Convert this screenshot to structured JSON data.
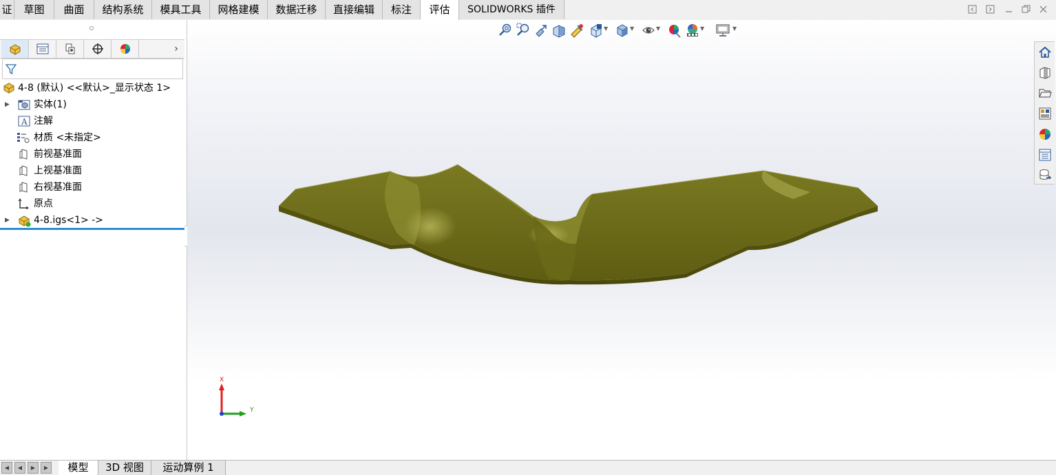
{
  "ribbon": {
    "tabs": [
      {
        "label": "证"
      },
      {
        "label": "草图"
      },
      {
        "label": "曲面"
      },
      {
        "label": "结构系统"
      },
      {
        "label": "模具工具"
      },
      {
        "label": "网格建模"
      },
      {
        "label": "数据迁移"
      },
      {
        "label": "直接编辑"
      },
      {
        "label": "标注"
      },
      {
        "label": "评估"
      },
      {
        "label": "SOLIDWORKS 插件"
      }
    ],
    "active_tab": "评估"
  },
  "window_controls": [
    "restore-left-icon",
    "restore-right-icon",
    "minimize-icon",
    "maximize-icon",
    "close-icon"
  ],
  "feature_manager": {
    "panel_tabs": [
      "feature-manager-icon",
      "property-manager-icon",
      "configuration-manager-icon",
      "dimxpert-icon",
      "display-manager-icon"
    ],
    "more_arrow": "›",
    "tree": [
      {
        "label": "4-8 (默认) <<默认>_显示状态 1>",
        "icon": "part-icon",
        "expandable": false
      },
      {
        "label": "实体(1)",
        "icon": "solid-bodies-icon",
        "expandable": true
      },
      {
        "label": "注解",
        "icon": "annotations-icon",
        "expandable": false
      },
      {
        "label": "材质 <未指定>",
        "icon": "material-icon",
        "expandable": false
      },
      {
        "label": "前视基准面",
        "icon": "plane-icon",
        "expandable": false
      },
      {
        "label": "上视基准面",
        "icon": "plane-icon",
        "expandable": false
      },
      {
        "label": "右视基准面",
        "icon": "plane-icon",
        "expandable": false
      },
      {
        "label": "原点",
        "icon": "origin-icon",
        "expandable": false
      },
      {
        "label": "4-8.igs<1> ->",
        "icon": "imported-feature-icon",
        "expandable": true
      }
    ]
  },
  "view_toolbar": [
    "zoom-to-fit-icon",
    "zoom-to-area-icon",
    "previous-view-icon",
    "section-view-icon",
    "dynamic-annotation-icon",
    "view-orientation-icon",
    "display-style-icon",
    "hide-show-icon",
    "edit-appearance-icon",
    "apply-scene-icon",
    "view-settings-icon"
  ],
  "triad": {
    "x_label": "X",
    "y_label": "Y"
  },
  "task_pane": [
    "home-icon",
    "design-library-icon",
    "file-explorer-icon",
    "view-palette-icon",
    "appearances-icon",
    "custom-properties-icon",
    "solidworks-resources-icon"
  ],
  "bottom_tabs": {
    "tabs": [
      {
        "label": "模型"
      },
      {
        "label": "3D 视图"
      },
      {
        "label": "运动算例 1"
      }
    ],
    "active_tab": "模型"
  },
  "colors": {
    "model": "#6b6a1a",
    "selection_line": "#2a8bd6"
  }
}
